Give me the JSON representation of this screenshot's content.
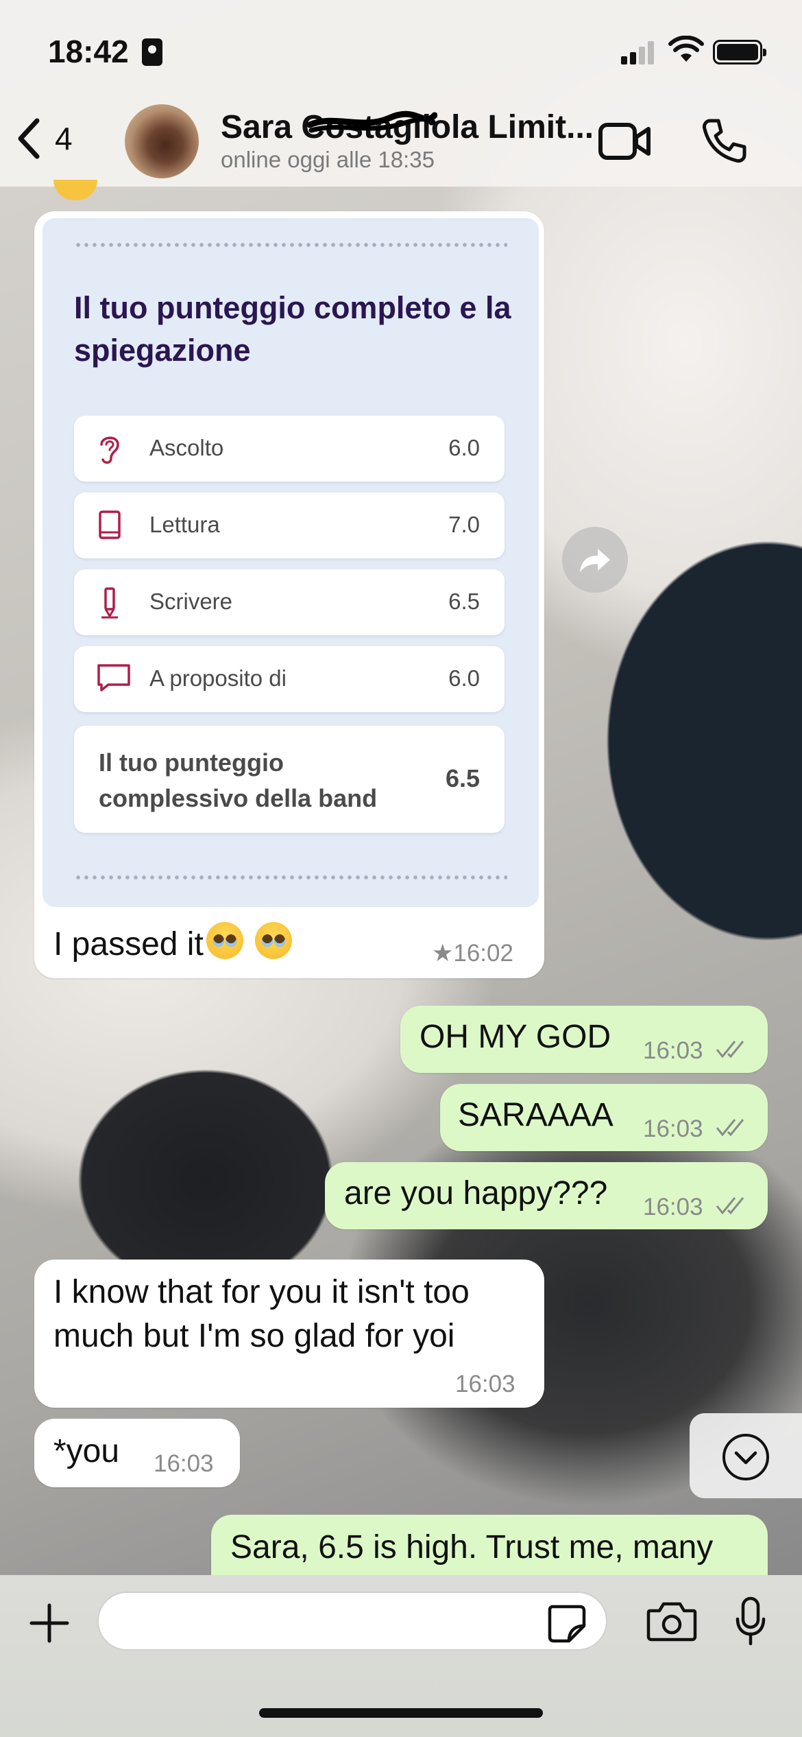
{
  "status_bar": {
    "time": "18:42"
  },
  "header": {
    "back_count": "4",
    "contact_name": "Sara Costagliola Limit...",
    "contact_status": "online oggi alle 18:35"
  },
  "score_card": {
    "title": "Il tuo punteggio completo e la spiegazione",
    "rows": [
      {
        "icon": "ear-icon",
        "label": "Ascolto",
        "value": "6.0"
      },
      {
        "icon": "book-icon",
        "label": "Lettura",
        "value": "7.0"
      },
      {
        "icon": "pen-icon",
        "label": "Scrivere",
        "value": "6.5"
      },
      {
        "icon": "speech-bubble-icon",
        "label": "A proposito di",
        "value": "6.0"
      }
    ],
    "total": {
      "label": "Il tuo punteggio complessivo della band",
      "value": "6.5"
    }
  },
  "messages": [
    {
      "dir": "in",
      "text": "I passed it",
      "time": "★16:02"
    },
    {
      "dir": "out",
      "text": "OH MY GOD",
      "time": "16:03"
    },
    {
      "dir": "out",
      "text": "SARAAAA",
      "time": "16:03"
    },
    {
      "dir": "out",
      "text": "are you happy???",
      "time": "16:03"
    },
    {
      "dir": "in",
      "text_line1": "I know that for you it isn't  too",
      "text_line2": "much but I'm so glad for yoi",
      "time": "16:03"
    },
    {
      "dir": "in",
      "text": "*you",
      "time": "16:03"
    },
    {
      "dir": "out",
      "text": "Sara, 6.5 is high. Trust me, many"
    }
  ],
  "input": {
    "placeholder": ""
  },
  "colors": {
    "incoming_bubble": "#ffffff",
    "outgoing_bubble": "#dcf8c7",
    "card_background": "#e2ebf6",
    "card_title": "#2b1650",
    "icon_accent": "#b01e4a"
  }
}
